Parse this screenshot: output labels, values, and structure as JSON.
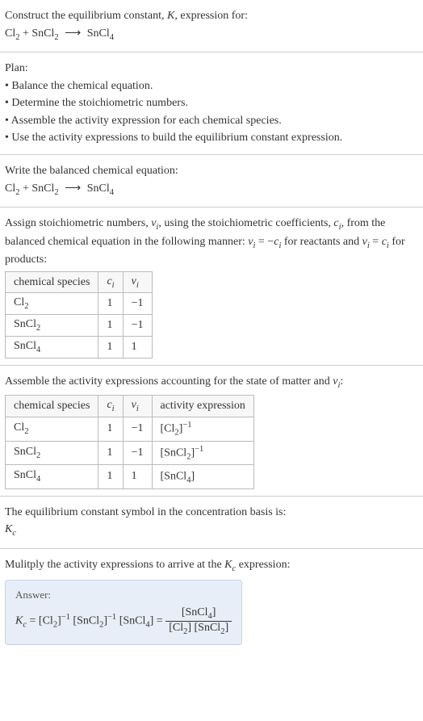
{
  "header": {
    "prompt_prefix": "Construct the equilibrium constant, ",
    "prompt_K": "K",
    "prompt_suffix": ", expression for:"
  },
  "equation": {
    "r1": "Cl",
    "r1_sub": "2",
    "plus": " + ",
    "r2": "SnCl",
    "r2_sub": "2",
    "arrow": "⟶",
    "p1": "SnCl",
    "p1_sub": "4"
  },
  "plan": {
    "title": "Plan:",
    "b1": "• Balance the chemical equation.",
    "b2": "• Determine the stoichiometric numbers.",
    "b3": "• Assemble the activity expression for each chemical species.",
    "b4": "• Use the activity expressions to build the equilibrium constant expression."
  },
  "balanced": {
    "title": "Write the balanced chemical equation:"
  },
  "stoich": {
    "text_a": "Assign stoichiometric numbers, ",
    "nu_i": "ν",
    "nu_i_sub": "i",
    "text_b": ", using the stoichiometric coefficients, ",
    "c_i": "c",
    "c_i_sub": "i",
    "text_c": ", from the balanced chemical equation in the following manner: ",
    "eq1_lhs": "ν",
    "eq1_lhs_sub": "i",
    "eq1_mid": " = −",
    "eq1_rhs": "c",
    "eq1_rhs_sub": "i",
    "text_d": " for reactants and ",
    "eq2_lhs": "ν",
    "eq2_lhs_sub": "i",
    "eq2_mid": " = ",
    "eq2_rhs": "c",
    "eq2_rhs_sub": "i",
    "text_e": " for products:",
    "hdr_species": "chemical species",
    "hdr_c": "c",
    "hdr_c_sub": "i",
    "hdr_nu": "ν",
    "hdr_nu_sub": "i",
    "rows": [
      {
        "sp": "Cl",
        "sp_sub": "2",
        "c": "1",
        "nu": "−1"
      },
      {
        "sp": "SnCl",
        "sp_sub": "2",
        "c": "1",
        "nu": "−1"
      },
      {
        "sp": "SnCl",
        "sp_sub": "4",
        "c": "1",
        "nu": "1"
      }
    ]
  },
  "activity": {
    "text_a": "Assemble the activity expressions accounting for the state of matter and ",
    "nu": "ν",
    "nu_sub": "i",
    "text_b": ":",
    "hdr_species": "chemical species",
    "hdr_c": "c",
    "hdr_c_sub": "i",
    "hdr_nu": "ν",
    "hdr_nu_sub": "i",
    "hdr_act": "activity expression",
    "rows": [
      {
        "sp": "Cl",
        "sp_sub": "2",
        "c": "1",
        "nu": "−1",
        "act_base": "[Cl",
        "act_sub": "2",
        "act_close": "]",
        "act_exp": "−1"
      },
      {
        "sp": "SnCl",
        "sp_sub": "2",
        "c": "1",
        "nu": "−1",
        "act_base": "[SnCl",
        "act_sub": "2",
        "act_close": "]",
        "act_exp": "−1"
      },
      {
        "sp": "SnCl",
        "sp_sub": "4",
        "c": "1",
        "nu": "1",
        "act_base": "[SnCl",
        "act_sub": "4",
        "act_close": "]",
        "act_exp": ""
      }
    ]
  },
  "symbol": {
    "text": "The equilibrium constant symbol in the concentration basis is:",
    "K": "K",
    "K_sub": "c"
  },
  "multiply": {
    "text_a": "Mulitply the activity expressions to arrive at the ",
    "K": "K",
    "K_sub": "c",
    "text_b": " expression:"
  },
  "answer": {
    "label": "Answer:",
    "Kc": "K",
    "Kc_sub": "c",
    "eq": " = ",
    "t1": "[Cl",
    "t1_sub": "2",
    "t1_close": "]",
    "t1_exp": "−1",
    "sp": " ",
    "t2": "[SnCl",
    "t2_sub": "2",
    "t2_close": "]",
    "t2_exp": "−1",
    "t3": "[SnCl",
    "t3_sub": "4",
    "t3_close": "]",
    "eq2": " = ",
    "num": "[SnCl",
    "num_sub": "4",
    "num_close": "]",
    "den_a": "[Cl",
    "den_a_sub": "2",
    "den_a_close": "]",
    "den_b": " [SnCl",
    "den_b_sub": "2",
    "den_b_close": "]"
  },
  "chart_data": {
    "type": "table",
    "tables": [
      {
        "title": "Stoichiometric numbers",
        "columns": [
          "chemical species",
          "c_i",
          "ν_i"
        ],
        "rows": [
          [
            "Cl2",
            1,
            -1
          ],
          [
            "SnCl2",
            1,
            -1
          ],
          [
            "SnCl4",
            1,
            1
          ]
        ]
      },
      {
        "title": "Activity expressions",
        "columns": [
          "chemical species",
          "c_i",
          "ν_i",
          "activity expression"
        ],
        "rows": [
          [
            "Cl2",
            1,
            -1,
            "[Cl2]^-1"
          ],
          [
            "SnCl2",
            1,
            -1,
            "[SnCl2]^-1"
          ],
          [
            "SnCl4",
            1,
            1,
            "[SnCl4]"
          ]
        ]
      }
    ]
  }
}
